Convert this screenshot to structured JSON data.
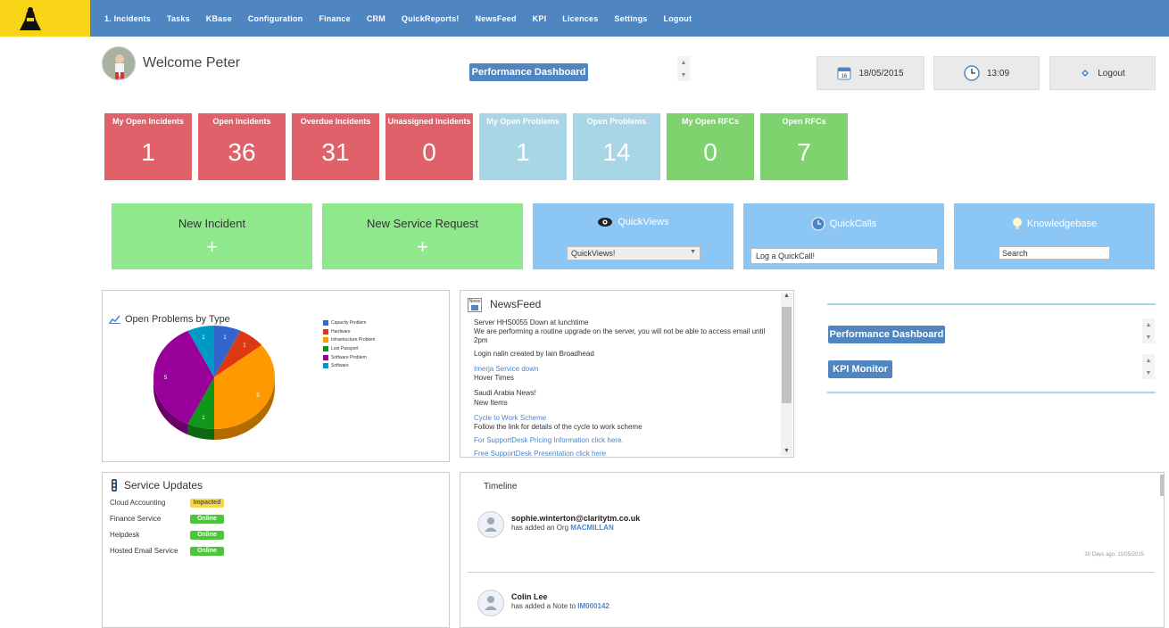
{
  "nav": [
    "1. Incidents",
    "Tasks",
    "KBase",
    "Configuration",
    "Finance",
    "CRM",
    "QuickReports!",
    "NewsFeed",
    "KPI",
    "Licences",
    "Settings",
    "Logout"
  ],
  "welcome": "Welcome Peter",
  "perf_dashboard": "Performance Dashboard",
  "date": "18/05/2015",
  "time": "13:09",
  "logout": "Logout",
  "tiles": [
    {
      "label": "My Open Incidents",
      "value": "1",
      "color": "red"
    },
    {
      "label": "Open Incidents",
      "value": "36",
      "color": "red"
    },
    {
      "label": "Overdue Incidents",
      "value": "31",
      "color": "red"
    },
    {
      "label": "Unassigned Incidents",
      "value": "0",
      "color": "red"
    },
    {
      "label": "My Open Problems",
      "value": "1",
      "color": "lblue"
    },
    {
      "label": "Open Problems",
      "value": "14",
      "color": "lblue"
    },
    {
      "label": "My Open RFCs",
      "value": "0",
      "color": "green"
    },
    {
      "label": "Open RFCs",
      "value": "7",
      "color": "green"
    }
  ],
  "actions": {
    "new_incident": "New Incident",
    "new_service_request": "New Service Request",
    "plus": "+",
    "quickviews": "QuickViews",
    "quickviews_select": "QuickViews!",
    "quickcalls": "QuickCalls",
    "quickcall_input": "Log a QuickCall!",
    "knowledgebase": "Knowledgebase",
    "kb_input": "Search"
  },
  "problems_chart": {
    "title": "Open Problems by Type"
  },
  "chart_data": {
    "type": "pie",
    "title": "Open Problems by Type",
    "categories": [
      "Capacity Problem",
      "Hardware",
      "Infrastructure Problem",
      "Lost Passport",
      "Software Problem",
      "Software"
    ],
    "values": [
      1,
      1,
      5,
      1,
      5,
      1
    ],
    "colors": [
      "#3366cc",
      "#dc3912",
      "#ff9900",
      "#109618",
      "#990099",
      "#0099c6"
    ],
    "legend": "right"
  },
  "newsfeed": {
    "title": "NewsFeed",
    "icon_label": "News",
    "items": [
      {
        "text": "Server HHS0055 Down at lunchtime",
        "link": false
      },
      {
        "text": "We are performing a routine upgrade on the server, you will not be able to access email until 2pm",
        "link": false
      },
      {
        "text": "Login nalin created by Iain Broadhead",
        "link": false
      },
      {
        "text": "Imerja Service down",
        "link": true
      },
      {
        "text": "Hover Times",
        "link": false
      },
      {
        "text": "Saudi Arabia News!",
        "link": false
      },
      {
        "text": "New Items",
        "link": false
      },
      {
        "text": "Cycle to Work Scheme",
        "link": true
      },
      {
        "text": "Follow the link for details of the cycle to work scheme",
        "link": false
      },
      {
        "text": "For SupportDesk Pricing Information click here.",
        "link": true
      },
      {
        "text": "Free SupportDesk Presentation click here",
        "link": true
      }
    ]
  },
  "right_panel": {
    "perf": "Performance Dashboard",
    "kpi": "KPI Monitor"
  },
  "service_updates": {
    "title": "Service Updates",
    "rows": [
      {
        "name": "Cloud Accounting",
        "status": "Impacted",
        "color": "#f5d742"
      },
      {
        "name": "Finance Service",
        "status": "Online",
        "color": "#4cc43b"
      },
      {
        "name": "Helpdesk",
        "status": "Online",
        "color": "#4cc43b"
      },
      {
        "name": "Hosted Email Service",
        "status": "Online",
        "color": "#4cc43b"
      }
    ]
  },
  "timeline": {
    "title": "Timeline",
    "entries": [
      {
        "user": "sophie.winterton@claritytm.co.uk",
        "action": "has added an Org",
        "target": "MACMILLAN",
        "time": "30 Days ago, 11/05/2015"
      },
      {
        "user": "Colin Lee",
        "action": "has added a Note to",
        "target": "IM000142",
        "time": ""
      }
    ]
  }
}
